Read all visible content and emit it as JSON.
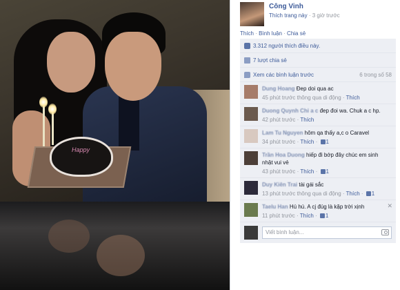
{
  "photo": {
    "cake_text": "Happy",
    "alt": ""
  },
  "owner": {
    "name": "Công Vinh",
    "like_page": "Thích trang này",
    "sep": "·",
    "time": "3 giờ trước"
  },
  "actions": {
    "like": "Thích",
    "comment": "Bình luận",
    "share": "Chia sẻ",
    "sep": " · "
  },
  "stats": {
    "likes": "3.312 người thích điều này.",
    "shares": "7 lượt chia sẻ",
    "view_previous": "Xem các bình luận trước",
    "count": "6 trong số 58"
  },
  "comments": [
    {
      "author": "Dung Hoang",
      "text": "Đep doi qua ac",
      "time": "45 phút trước thông qua di động",
      "reply": "Thích",
      "likes": "",
      "avatar_color": "#a67c6a"
    },
    {
      "author": "Duong Quynh Chi a c",
      "text": "đep đoi wa. Chuk a c hp.",
      "time": "42 phút trước",
      "reply": "Thích",
      "likes": "",
      "avatar_color": "#6b5a4e"
    },
    {
      "author": "Lam Tu Nguyen",
      "text": "hôm qa thấy a,c o Caravel",
      "time": "34 phút trước",
      "reply": "Thích",
      "likes": "1",
      "avatar_color": "#d8c9c0"
    },
    {
      "author": "Trần Hoa Duong",
      "text": "hiếp đi bớp đây chúc em sinh nhật vui vẻ",
      "time": "43 phút trước",
      "reply": "Thích",
      "likes": "1",
      "avatar_color": "#4c3f38"
    },
    {
      "author": "Duy Kiên Trai",
      "text": "tài gái sắc",
      "time": "13 phút trước thông qua di động",
      "reply": "Thích",
      "likes": "1",
      "avatar_color": "#2c2a3a"
    },
    {
      "author": "Taelu Han",
      "text": "Hú hú. A cj đúg là kặp trời xịnh",
      "time": "11 phút trước",
      "reply": "Thích",
      "likes": "1",
      "avatar_color": "#6a7a4e"
    }
  ],
  "compose": {
    "placeholder": "Viết bình luận..."
  },
  "colors": {
    "link": "#3b5998",
    "meta": "#90949c",
    "ufi_bg": "#edeff4"
  }
}
